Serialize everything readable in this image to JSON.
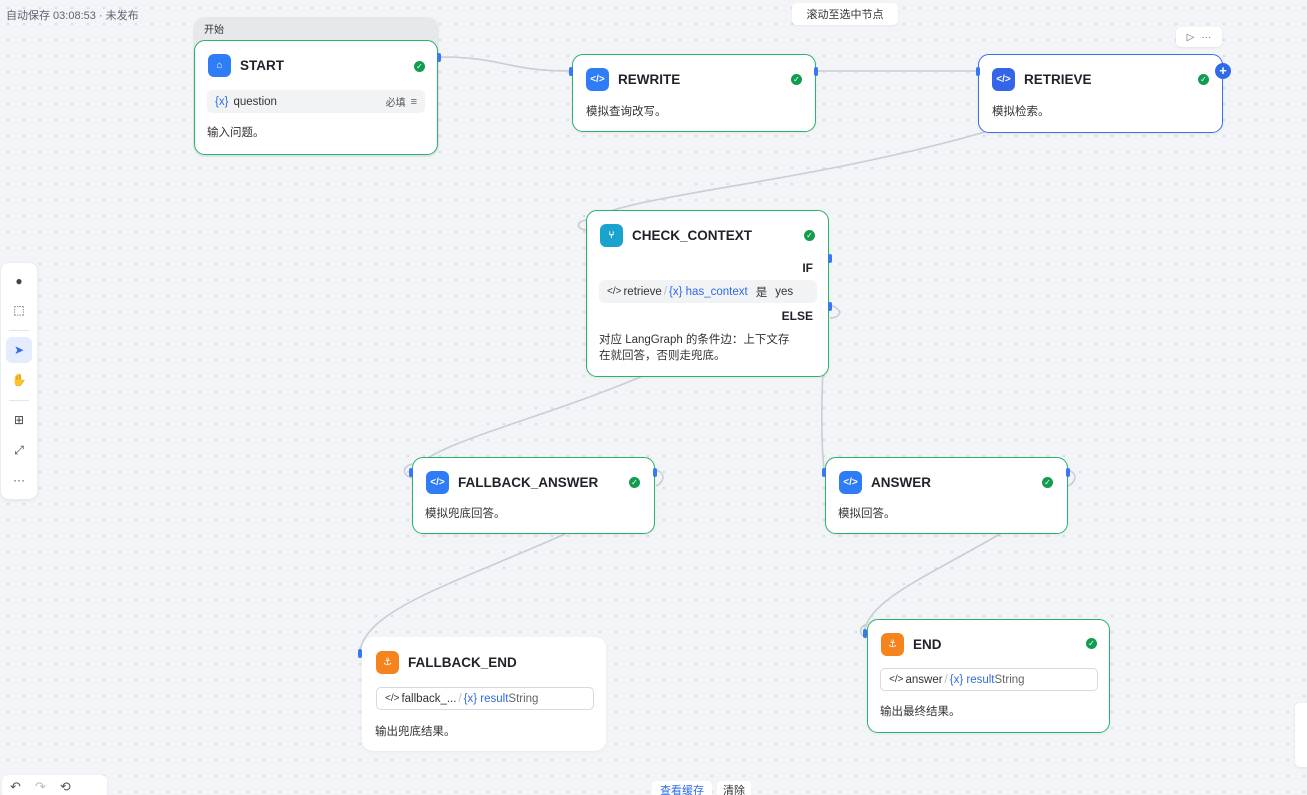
{
  "status": {
    "autosave": "自动保存 03:08:53 · 未发布"
  },
  "top_bar": {
    "scroll_to_selected": "滚动至选中节点"
  },
  "start_group": {
    "label": "开始"
  },
  "nodes": {
    "start": {
      "title": "START",
      "var_prefix": "{x}",
      "var_name": "question",
      "required": "必填",
      "desc": "输入问题。"
    },
    "rewrite": {
      "title": "REWRITE",
      "desc": "模拟查询改写。"
    },
    "retrieve": {
      "title": "RETRIEVE",
      "desc": "模拟检索。"
    },
    "check_context": {
      "title": "CHECK_CONTEXT",
      "if_label": "IF",
      "cond_source": "retrieve",
      "cond_var": "{x} has_context",
      "cond_op": "是",
      "cond_value": "yes",
      "else_label": "ELSE",
      "desc_line1": "对应 LangGraph 的条件边：上下文存",
      "desc_line2": "在就回答，否则走兜底。"
    },
    "fallback_answer": {
      "title": "FALLBACK_ANSWER",
      "desc": "模拟兜底回答。"
    },
    "answer": {
      "title": "ANSWER",
      "desc": "模拟回答。"
    },
    "fallback_end": {
      "title": "FALLBACK_END",
      "src": "fallback_...",
      "var": "{x} result",
      "type": "String",
      "desc": "输出兜底结果。"
    },
    "end": {
      "title": "END",
      "src": "answer",
      "var": "{x} result",
      "type": "String",
      "desc": "输出最终结果。"
    }
  },
  "bottom": {
    "view_cache": "查看缓存",
    "clear": "清除"
  },
  "icons": {
    "start": "home-icon",
    "code": "code-icon",
    "branch": "branch-icon",
    "end": "end-icon",
    "toolbar": [
      "add-node-icon",
      "add-note-icon",
      "pointer-icon",
      "hand-icon",
      "auto-layout-icon",
      "fit-view-icon",
      "more-icon"
    ]
  },
  "colors": {
    "success": "#129c4f",
    "selected": "#3a6ff0",
    "node_border": "#27b36b",
    "accent": "#2e6be6"
  }
}
